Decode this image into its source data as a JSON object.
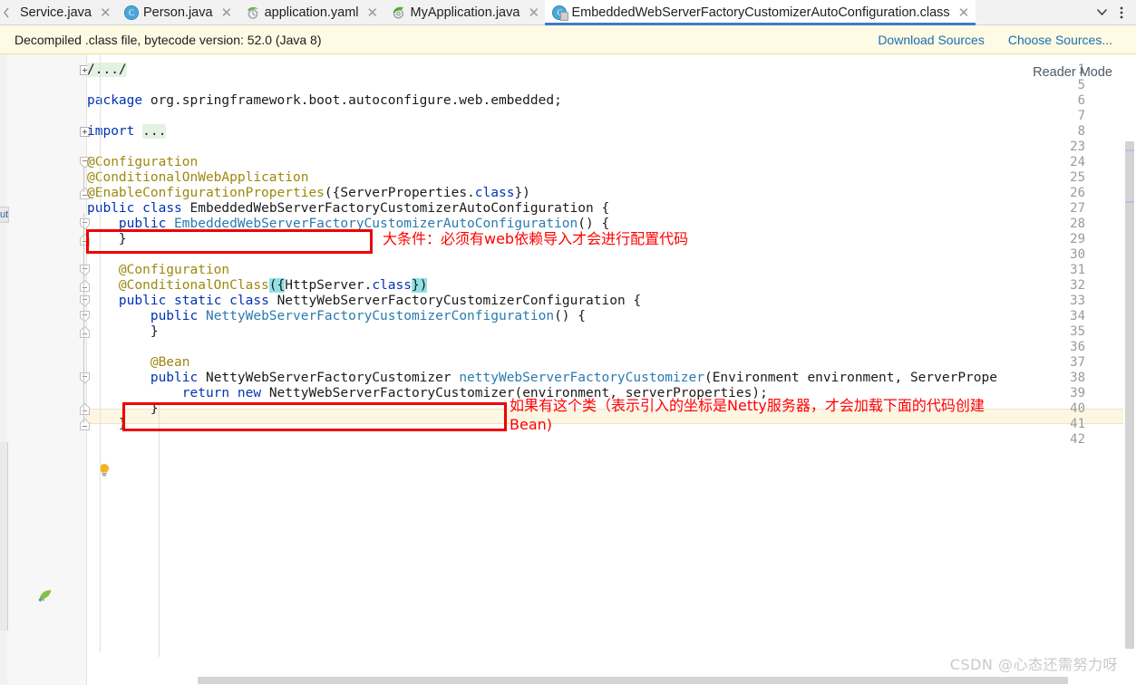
{
  "window": {
    "app": "IntelliJ IDEA editor"
  },
  "tabs": {
    "overflow_left_icon": "chevron-left-icon",
    "items": [
      {
        "label": "Service.java",
        "icon": "java-class-icon",
        "active": false,
        "closable": true
      },
      {
        "label": "Person.java",
        "icon": "java-class-icon",
        "active": false,
        "closable": true
      },
      {
        "label": "application.yaml",
        "icon": "spring-yaml-icon",
        "active": false,
        "closable": true
      },
      {
        "label": "MyApplication.java",
        "icon": "spring-boot-app-icon",
        "active": false,
        "closable": true
      },
      {
        "label": "EmbeddedWebServerFactoryCustomizerAutoConfiguration.class",
        "icon": "java-class-decompiled-icon",
        "active": true,
        "closable": true
      }
    ],
    "controls": [
      {
        "name": "tab-list-dropdown",
        "glyph": "∨"
      },
      {
        "name": "more-options-menu",
        "glyph": "⋮"
      }
    ]
  },
  "notification": {
    "message": "Decompiled .class file, bytecode version: 52.0 (Java 8)",
    "links": [
      {
        "label": "Download Sources",
        "name": "download-sources-link"
      },
      {
        "label": "Choose Sources...",
        "name": "choose-sources-link"
      }
    ]
  },
  "editor": {
    "reader_mode_label": "Reader Mode",
    "line_numbers": [
      1,
      5,
      6,
      7,
      8,
      23,
      24,
      25,
      26,
      27,
      28,
      29,
      30,
      31,
      32,
      33,
      34,
      35,
      36,
      37,
      38,
      39,
      40,
      41,
      42
    ],
    "current_line": 32,
    "code_lines": [
      {
        "num": 1,
        "html": "<span class=\"fold-ph\">/.../</span>"
      },
      {
        "num": 5,
        "html": ""
      },
      {
        "num": 6,
        "html": "<span class=\"kw\">package</span> <span class=\"ident\">org.springframework.boot.autoconfigure.web.embedded</span><span class=\"punct\">;</span>"
      },
      {
        "num": 7,
        "html": ""
      },
      {
        "num": 8,
        "html": "<span class=\"kw\">import</span> <span class=\"fold-ph\">...</span>"
      },
      {
        "num": 23,
        "html": ""
      },
      {
        "num": 24,
        "html": "<span class=\"ann\">@Configuration</span>"
      },
      {
        "num": 25,
        "html": "<span class=\"ann\">@ConditionalOnWebApplication</span>"
      },
      {
        "num": 26,
        "html": "<span class=\"ann\">@EnableConfigurationProperties</span><span class=\"punct\">({</span><span class=\"ident\">ServerProperties</span>.<span class=\"kw\">class</span><span class=\"punct\">})</span>"
      },
      {
        "num": 27,
        "html": "<span class=\"kw\">public</span> <span class=\"kw\">class</span> <span class=\"cls\">EmbeddedWebServerFactoryCustomizerAutoConfiguration</span> <span class=\"punct\">{</span>"
      },
      {
        "num": 28,
        "html": "    <span class=\"kw\">public</span> <span class=\"meth\">EmbeddedWebServerFactoryCustomizerAutoConfiguration</span><span class=\"punct\">() {</span>"
      },
      {
        "num": 29,
        "html": "    <span class=\"punct\">}</span>"
      },
      {
        "num": 30,
        "html": ""
      },
      {
        "num": 31,
        "html": "    <span class=\"ann\">@Configuration</span>"
      },
      {
        "num": 32,
        "html": "    <span class=\"ann\">@ConditionalOnClass</span><span class=\"punct brkt-hl\">(</span><span class=\"punct brkt-hl\">{</span><span class=\"ident\">HttpServer</span>.<span class=\"kw\">class</span><span class=\"punct brkt-hl\">}</span><span class=\"punct brkt-hl\">)</span>"
      },
      {
        "num": 33,
        "html": "    <span class=\"kw\">public</span> <span class=\"kw\">static</span> <span class=\"kw\">class</span> <span class=\"cls\">NettyWebServerFactoryCustomizerConfiguration</span> <span class=\"punct\">{</span>"
      },
      {
        "num": 34,
        "html": "        <span class=\"kw\">public</span> <span class=\"meth\">NettyWebServerFactoryCustomizerConfiguration</span><span class=\"punct\">() {</span>"
      },
      {
        "num": 35,
        "html": "        <span class=\"punct\">}</span>"
      },
      {
        "num": 36,
        "html": ""
      },
      {
        "num": 37,
        "html": "        <span class=\"ann\">@Bean</span>"
      },
      {
        "num": 38,
        "html": "        <span class=\"kw\">public</span> <span class=\"cls\">NettyWebServerFactoryCustomizer</span> <span class=\"meth\">nettyWebServerFactoryCustomizer</span><span class=\"punct\">(</span><span class=\"ident\">Environment</span> <span class=\"ident\">environment</span><span class=\"punct\">,</span> <span class=\"ident\">ServerPrope</span>"
      },
      {
        "num": 39,
        "html": "            <span class=\"kw\">return</span> <span class=\"kw\">new</span> <span class=\"ident\">NettyWebServerFactoryCustomizer</span><span class=\"punct\">(</span><span class=\"ident\">environment</span><span class=\"punct\">,</span> <span class=\"ident\">serverProperties</span><span class=\"punct\">);</span>"
      },
      {
        "num": 40,
        "html": "        <span class=\"punct\">}</span>"
      },
      {
        "num": 41,
        "html": "    <span class=\"punct\">}</span>"
      },
      {
        "num": 42,
        "html": ""
      }
    ],
    "gutter_icons": [
      {
        "name": "intention-bulb-icon",
        "line": 32
      },
      {
        "name": "spring-bean-gutter-icon",
        "line": 37
      }
    ]
  },
  "annotations": {
    "boxes": [
      {
        "name": "highlight-box-conditional-on-web-application",
        "target_line": 25
      },
      {
        "name": "highlight-box-conditional-on-class",
        "target_line": 32
      }
    ],
    "notes": [
      {
        "name": "annotation-note-web-condition",
        "text": "大条件：必须有web依赖导入才会进行配置代码"
      },
      {
        "name": "annotation-note-netty-condition",
        "line1": "如果有这个类（表示引入的坐标是Netty服务器，才会加载下面的代码创建",
        "line2": "Bean)"
      }
    ],
    "color": "#ff0000"
  },
  "watermark": {
    "text": "CSDN @心态还需努力呀"
  }
}
